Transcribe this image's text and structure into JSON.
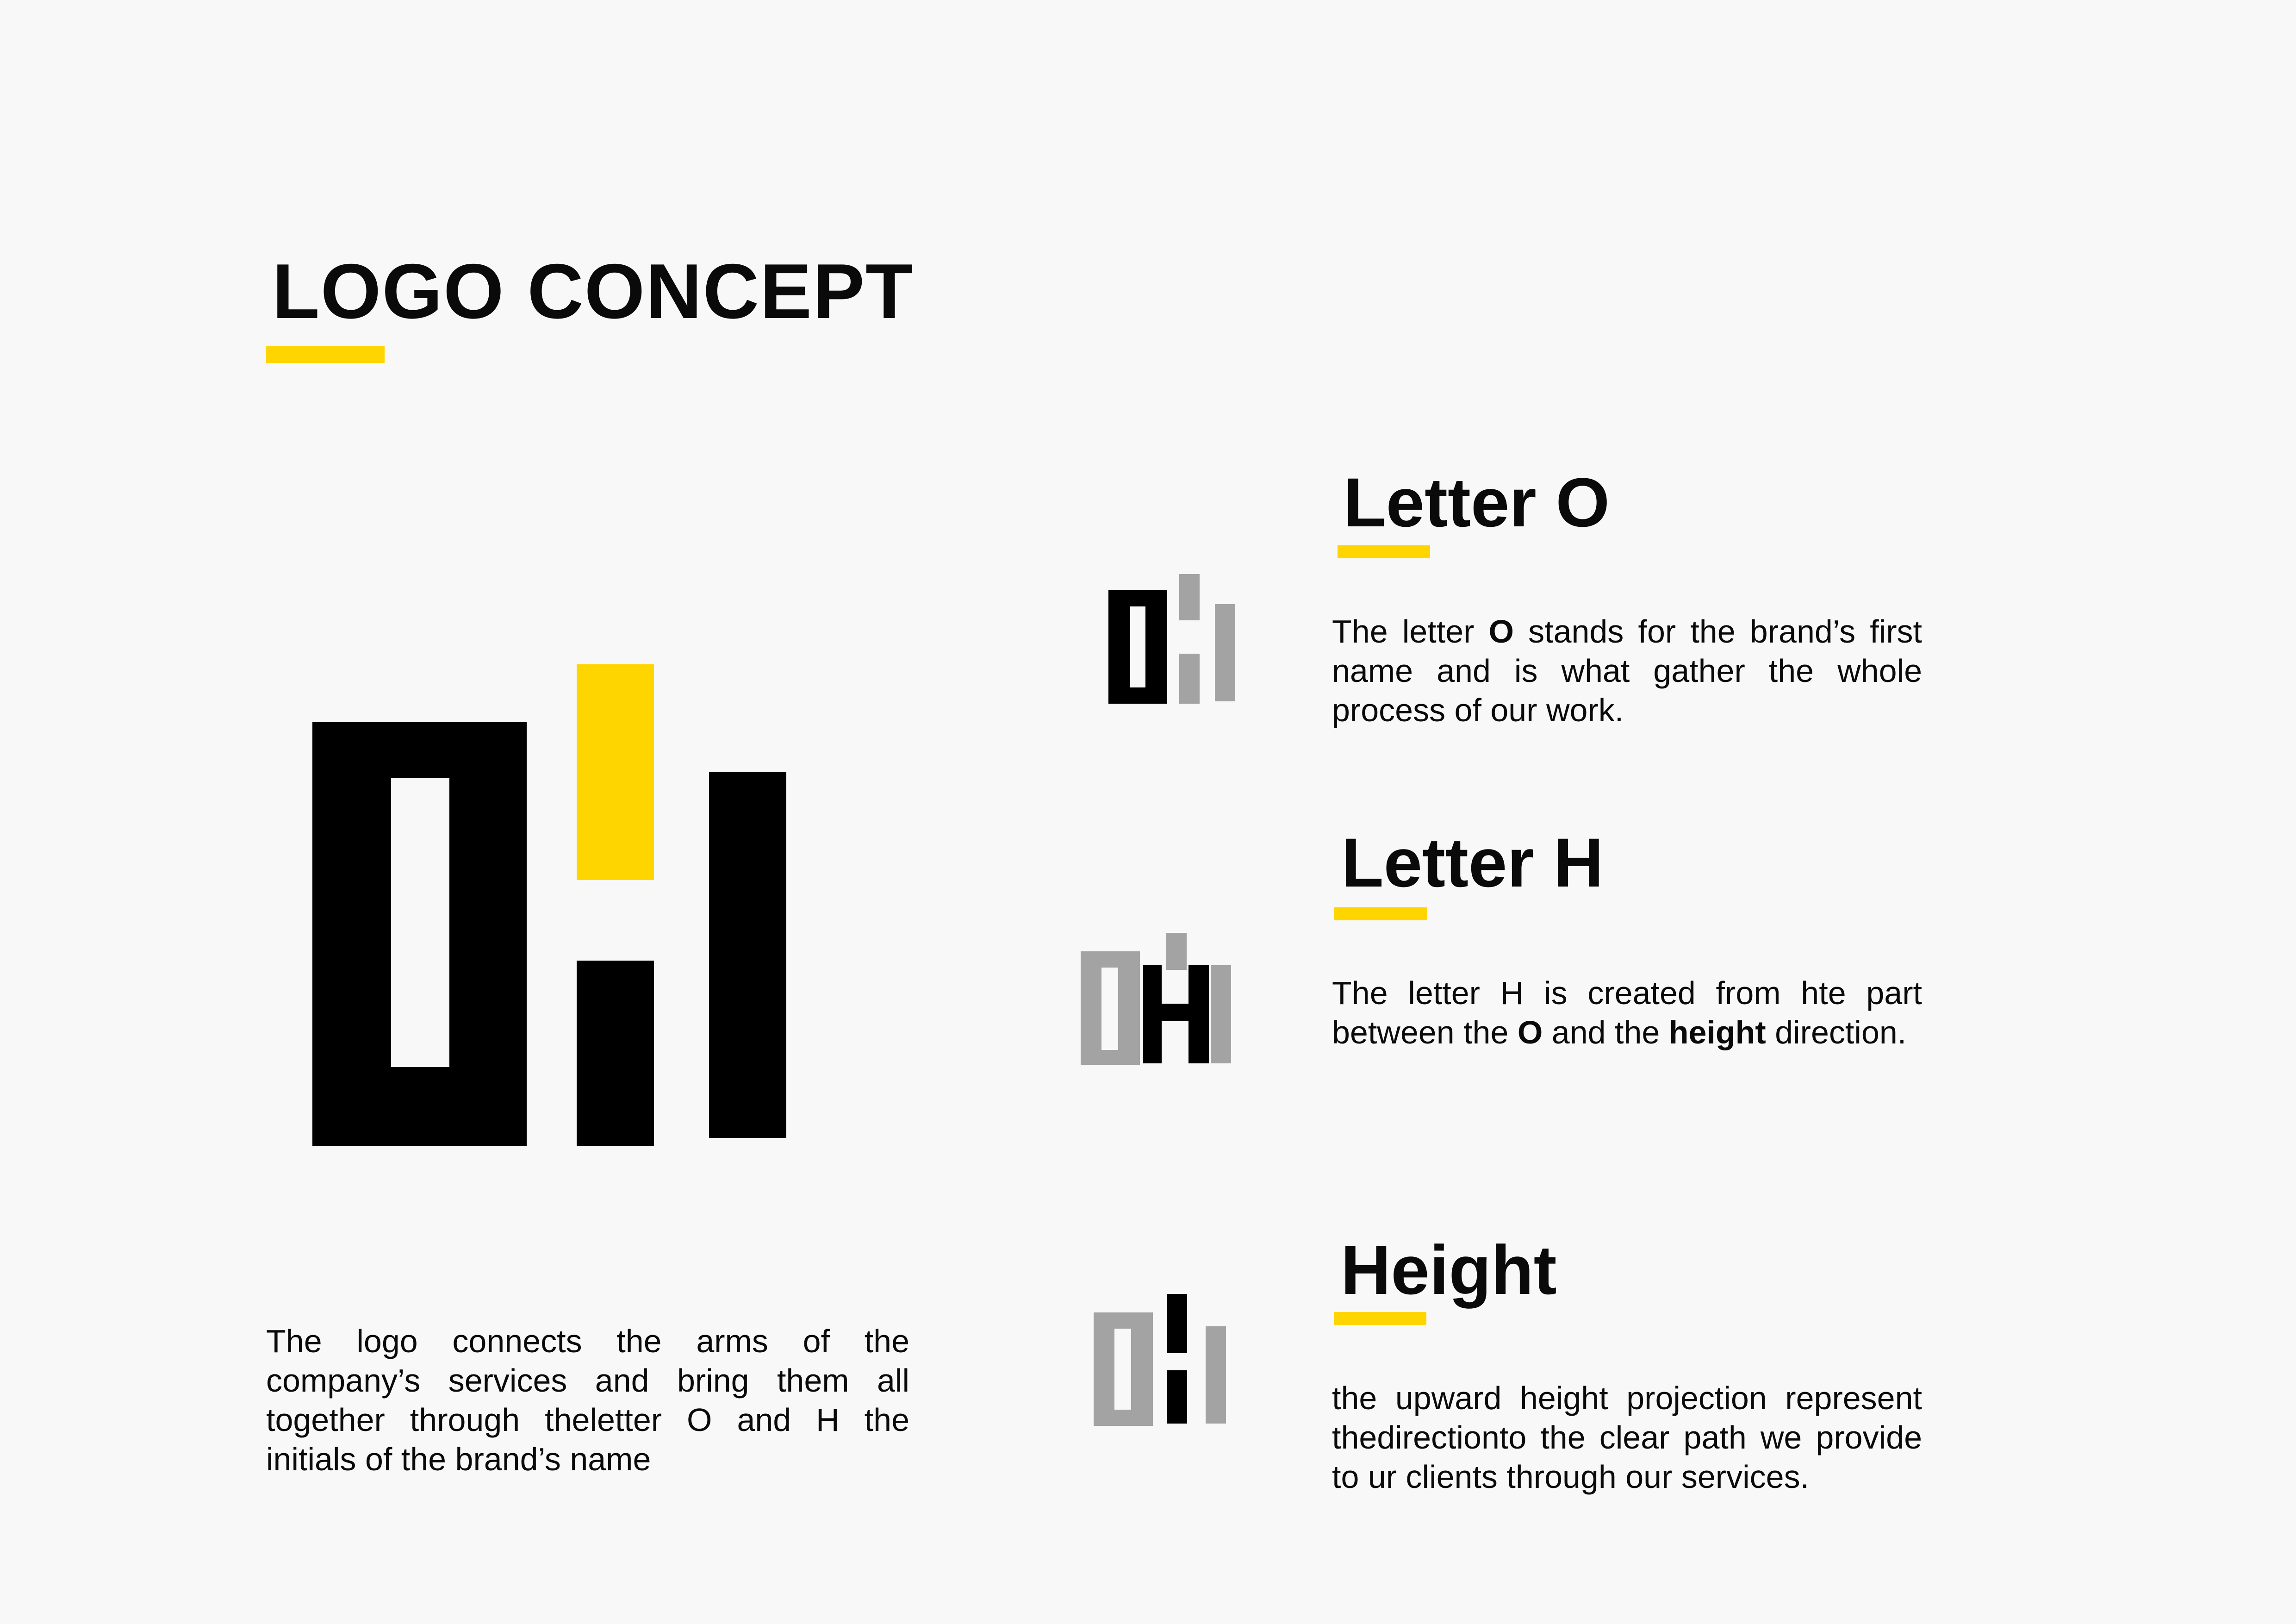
{
  "page": {
    "title": "LOGO CONCEPT",
    "intro_text": "The logo connects the arms of the company’s services and bring them all together through theletter O and H the initials of the brand’s name"
  },
  "colors": {
    "accent": "#ffd500",
    "primary": "#000000",
    "secondary": "#a3a3a3",
    "background": "#f8f8f8"
  },
  "sections": [
    {
      "heading": "Letter O",
      "text_before": "The letter ",
      "text_bold": "O",
      "text_after": " stands for the brand’s first name and is what gather the whole process of our work."
    },
    {
      "heading": "Letter H",
      "text_before": "The letter H is created from hte part between the ",
      "text_bold": "O",
      "text_middle": " and the ",
      "text_bold_2": "height",
      "text_after": " direction."
    },
    {
      "heading": "Height",
      "text": "the upward height projection represent thedirectionto the clear path we provide to ur clients through our services."
    }
  ]
}
